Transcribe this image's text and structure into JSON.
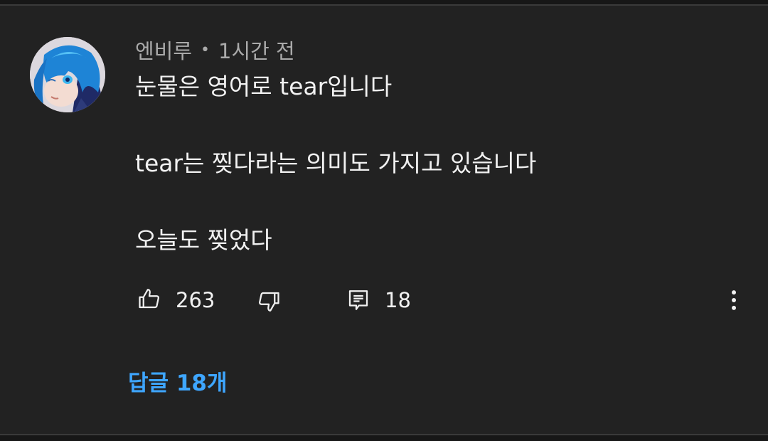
{
  "comment": {
    "author": "엔비루",
    "separator": "•",
    "timestamp": "1시간 전",
    "lines": [
      "눈물은 영어로 tear입니다",
      "tear는 찢다라는 의미도 가지고 있습니다",
      "오늘도 찢었다"
    ]
  },
  "actions": {
    "like_icon": "thumbs-up-icon",
    "like_count": "263",
    "dislike_icon": "thumbs-down-icon",
    "reply_icon": "comment-icon",
    "reply_count": "18",
    "more_icon": "more-vert-icon"
  },
  "replies": {
    "label": "답글 18개"
  },
  "colors": {
    "background": "#222222",
    "text_primary": "#f1f1f1",
    "text_secondary": "#aaaaaa",
    "link": "#3ea6ff"
  }
}
